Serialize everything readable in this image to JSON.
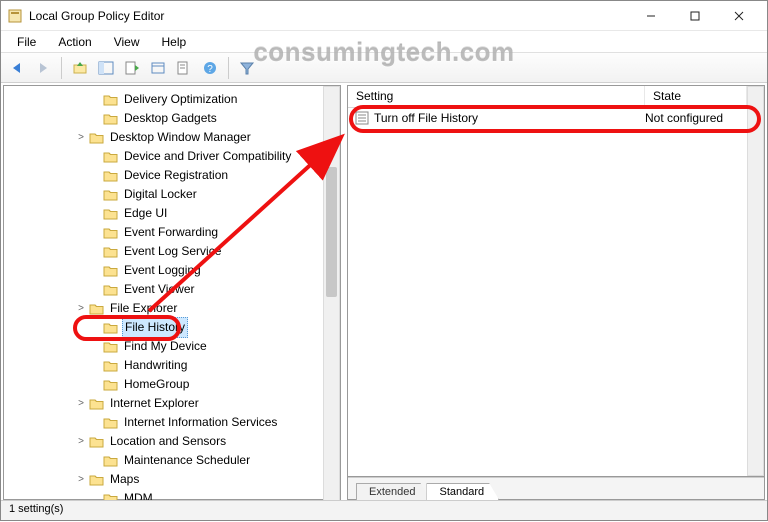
{
  "window": {
    "title": "Local Group Policy Editor"
  },
  "menubar": [
    "File",
    "Action",
    "View",
    "Help"
  ],
  "toolbar_icons": [
    "back-arrow-icon",
    "forward-arrow-icon",
    "sep",
    "folder-up-icon",
    "show-hide-tree-icon",
    "export-list-icon",
    "refresh-icon",
    "properties-icon",
    "help-icon",
    "sep",
    "filter-icon"
  ],
  "tree": [
    {
      "indent": 80,
      "twisty": "",
      "label": "Delivery Optimization"
    },
    {
      "indent": 80,
      "twisty": "",
      "label": "Desktop Gadgets"
    },
    {
      "indent": 66,
      "twisty": ">",
      "label": "Desktop Window Manager"
    },
    {
      "indent": 80,
      "twisty": "",
      "label": "Device and Driver Compatibility"
    },
    {
      "indent": 80,
      "twisty": "",
      "label": "Device Registration"
    },
    {
      "indent": 80,
      "twisty": "",
      "label": "Digital Locker"
    },
    {
      "indent": 80,
      "twisty": "",
      "label": "Edge UI"
    },
    {
      "indent": 80,
      "twisty": "",
      "label": "Event Forwarding"
    },
    {
      "indent": 80,
      "twisty": "",
      "label": "Event Log Service"
    },
    {
      "indent": 80,
      "twisty": "",
      "label": "Event Logging"
    },
    {
      "indent": 80,
      "twisty": "",
      "label": "Event Viewer"
    },
    {
      "indent": 66,
      "twisty": ">",
      "label": "File Explorer"
    },
    {
      "indent": 80,
      "twisty": "",
      "label": "File History",
      "selected": true
    },
    {
      "indent": 80,
      "twisty": "",
      "label": "Find My Device"
    },
    {
      "indent": 80,
      "twisty": "",
      "label": "Handwriting"
    },
    {
      "indent": 80,
      "twisty": "",
      "label": "HomeGroup"
    },
    {
      "indent": 66,
      "twisty": ">",
      "label": "Internet Explorer"
    },
    {
      "indent": 80,
      "twisty": "",
      "label": "Internet Information Services"
    },
    {
      "indent": 66,
      "twisty": ">",
      "label": "Location and Sensors"
    },
    {
      "indent": 80,
      "twisty": "",
      "label": "Maintenance Scheduler"
    },
    {
      "indent": 66,
      "twisty": ">",
      "label": "Maps"
    },
    {
      "indent": 80,
      "twisty": "",
      "label": "MDM"
    }
  ],
  "list": {
    "columns": {
      "setting": "Setting",
      "state": "State"
    },
    "rows": [
      {
        "setting": "Turn off File History",
        "state": "Not configured"
      }
    ]
  },
  "tabs": {
    "extended": "Extended",
    "standard": "Standard",
    "active": "standard"
  },
  "status": "1 setting(s)",
  "watermark": "consumingtech.com"
}
